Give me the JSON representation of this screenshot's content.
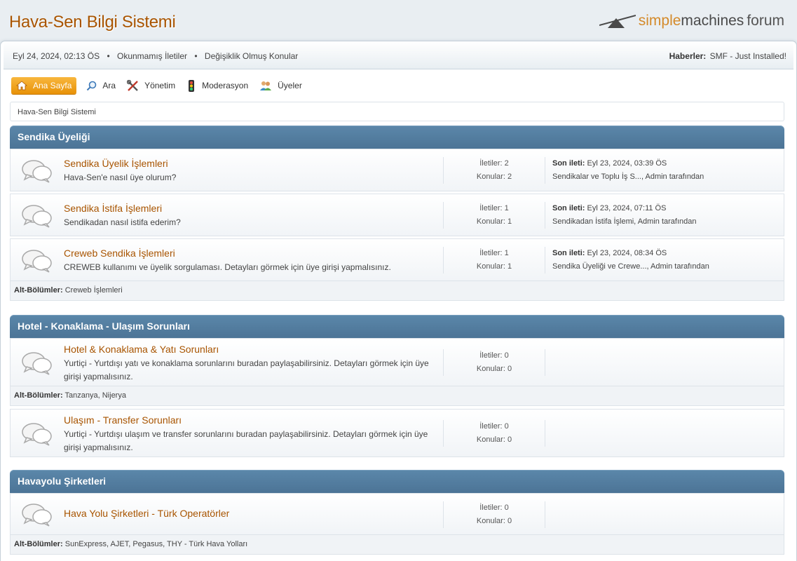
{
  "header": {
    "forum_title": "Hava-Sen Bilgi Sistemi",
    "logo_part1": "simple",
    "logo_part2": "machines",
    "logo_part3": "forum"
  },
  "upper": {
    "datetime": "Eyl 24, 2024, 02:13 ÖS",
    "unread_label": "Okunmamış İletiler",
    "updated_label": "Değişiklik Olmuş Konular",
    "news_label": "Haberler:",
    "news_text": "SMF - Just Installed!"
  },
  "menu": {
    "home": "Ana Sayfa",
    "search": "Ara",
    "admin": "Yönetim",
    "moderate": "Moderasyon",
    "members": "Üyeler"
  },
  "linktree": "Hava-Sen Bilgi Sistemi",
  "labels": {
    "posts": "İletiler:",
    "topics": "Konular:",
    "last_post": "Son ileti:",
    "by": "tarafından",
    "children": "Alt-Bölümler:"
  },
  "categories": [
    {
      "name": "Sendika Üyeliği",
      "boards": [
        {
          "title": "Sendika Üyelik İşlemleri",
          "desc": "Hava-Sen'e nasıl üye olurum?",
          "posts": "2",
          "topics": "2",
          "last_time": "Eyl 23, 2024, 03:39 ÖS",
          "last_topic": "Sendikalar ve Toplu İş S...",
          "last_author": "Admin"
        },
        {
          "title": "Sendika İstifa İşlemleri",
          "desc": "Sendikadan nasıl istifa ederim?",
          "posts": "1",
          "topics": "1",
          "last_time": "Eyl 23, 2024, 07:11 ÖS",
          "last_topic": "Sendikadan İstifa İşlemi",
          "last_author": "Admin"
        },
        {
          "title": "Creweb Sendika İşlemleri",
          "desc": "CREWEB kullanımı ve üyelik sorgulaması. Detayları görmek için üye girişi yapmalısınız.",
          "posts": "1",
          "topics": "1",
          "last_time": "Eyl 23, 2024, 08:34 ÖS",
          "last_topic": "Sendika Üyeliği ve Crewe...",
          "last_author": "Admin",
          "children": "Creweb İşlemleri"
        }
      ]
    },
    {
      "name": "Hotel - Konaklama - Ulaşım Sorunları",
      "boards": [
        {
          "title": "Hotel & Konaklama & Yatı Sorunları",
          "desc": "Yurtiçi - Yurtdışı yatı ve konaklama sorunlarını buradan paylaşabilirsiniz. Detayları görmek için üye girişi yapmalısınız.",
          "posts": "0",
          "topics": "0",
          "children": "Tanzanya, Nijerya"
        },
        {
          "title": "Ulaşım - Transfer Sorunları",
          "desc": "Yurtiçi - Yurtdışı ulaşım ve transfer sorunlarını buradan paylaşabilirsiniz. Detayları görmek için üye girişi yapmalısınız.",
          "posts": "0",
          "topics": "0"
        }
      ]
    },
    {
      "name": "Havayolu Şirketleri",
      "boards": [
        {
          "title": "Hava Yolu Şirketleri - Türk Operatörler",
          "desc": "",
          "posts": "0",
          "topics": "0",
          "children": "SunExpress, AJET, Pegasus, THY - Türk Hava Yolları"
        }
      ]
    }
  ]
}
